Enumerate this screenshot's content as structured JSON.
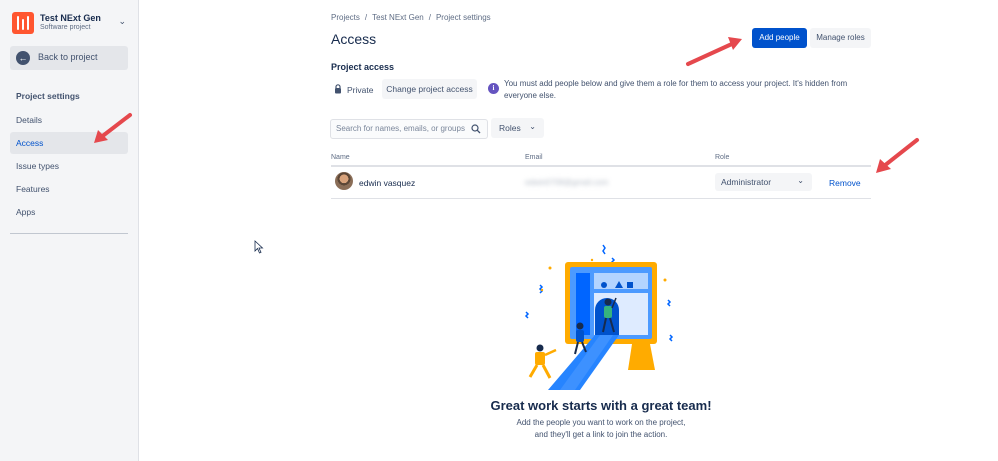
{
  "sidebar": {
    "project_name": "Test NExt Gen",
    "project_type": "Software project",
    "back_label": "Back to project",
    "heading": "Project settings",
    "items": [
      {
        "label": "Details"
      },
      {
        "label": "Access",
        "active": true
      },
      {
        "label": "Issue types"
      },
      {
        "label": "Features"
      },
      {
        "label": "Apps"
      }
    ]
  },
  "breadcrumb": [
    "Projects",
    "Test NExt Gen",
    "Project settings"
  ],
  "page_title": "Access",
  "actions": {
    "add_people": "Add people",
    "manage_roles": "Manage roles"
  },
  "project_access": {
    "heading": "Project access",
    "visibility": "Private",
    "change_button": "Change project access",
    "info_text": "You must add people below and give them a role for them to access your project. It's hidden from everyone else."
  },
  "search": {
    "placeholder": "Search for names, emails, or groups"
  },
  "roles_filter": "Roles",
  "table": {
    "headers": {
      "name": "Name",
      "email": "Email",
      "role": "Role"
    },
    "rows": [
      {
        "name": "edwin vasquez",
        "email": "edwin0708@gmail.com",
        "role": "Administrator",
        "action": "Remove"
      }
    ]
  },
  "empty_state": {
    "heading": "Great work starts with a great team!",
    "line1": "Add the people you want to work on the project,",
    "line2": "and they'll get a link to join the action."
  },
  "colors": {
    "primary": "#0052cc",
    "sidebar_bg": "#f4f5f7",
    "project_avatar": "#ff5630",
    "annotation_arrow": "#e5484d",
    "info_icon": "#6554c0"
  }
}
